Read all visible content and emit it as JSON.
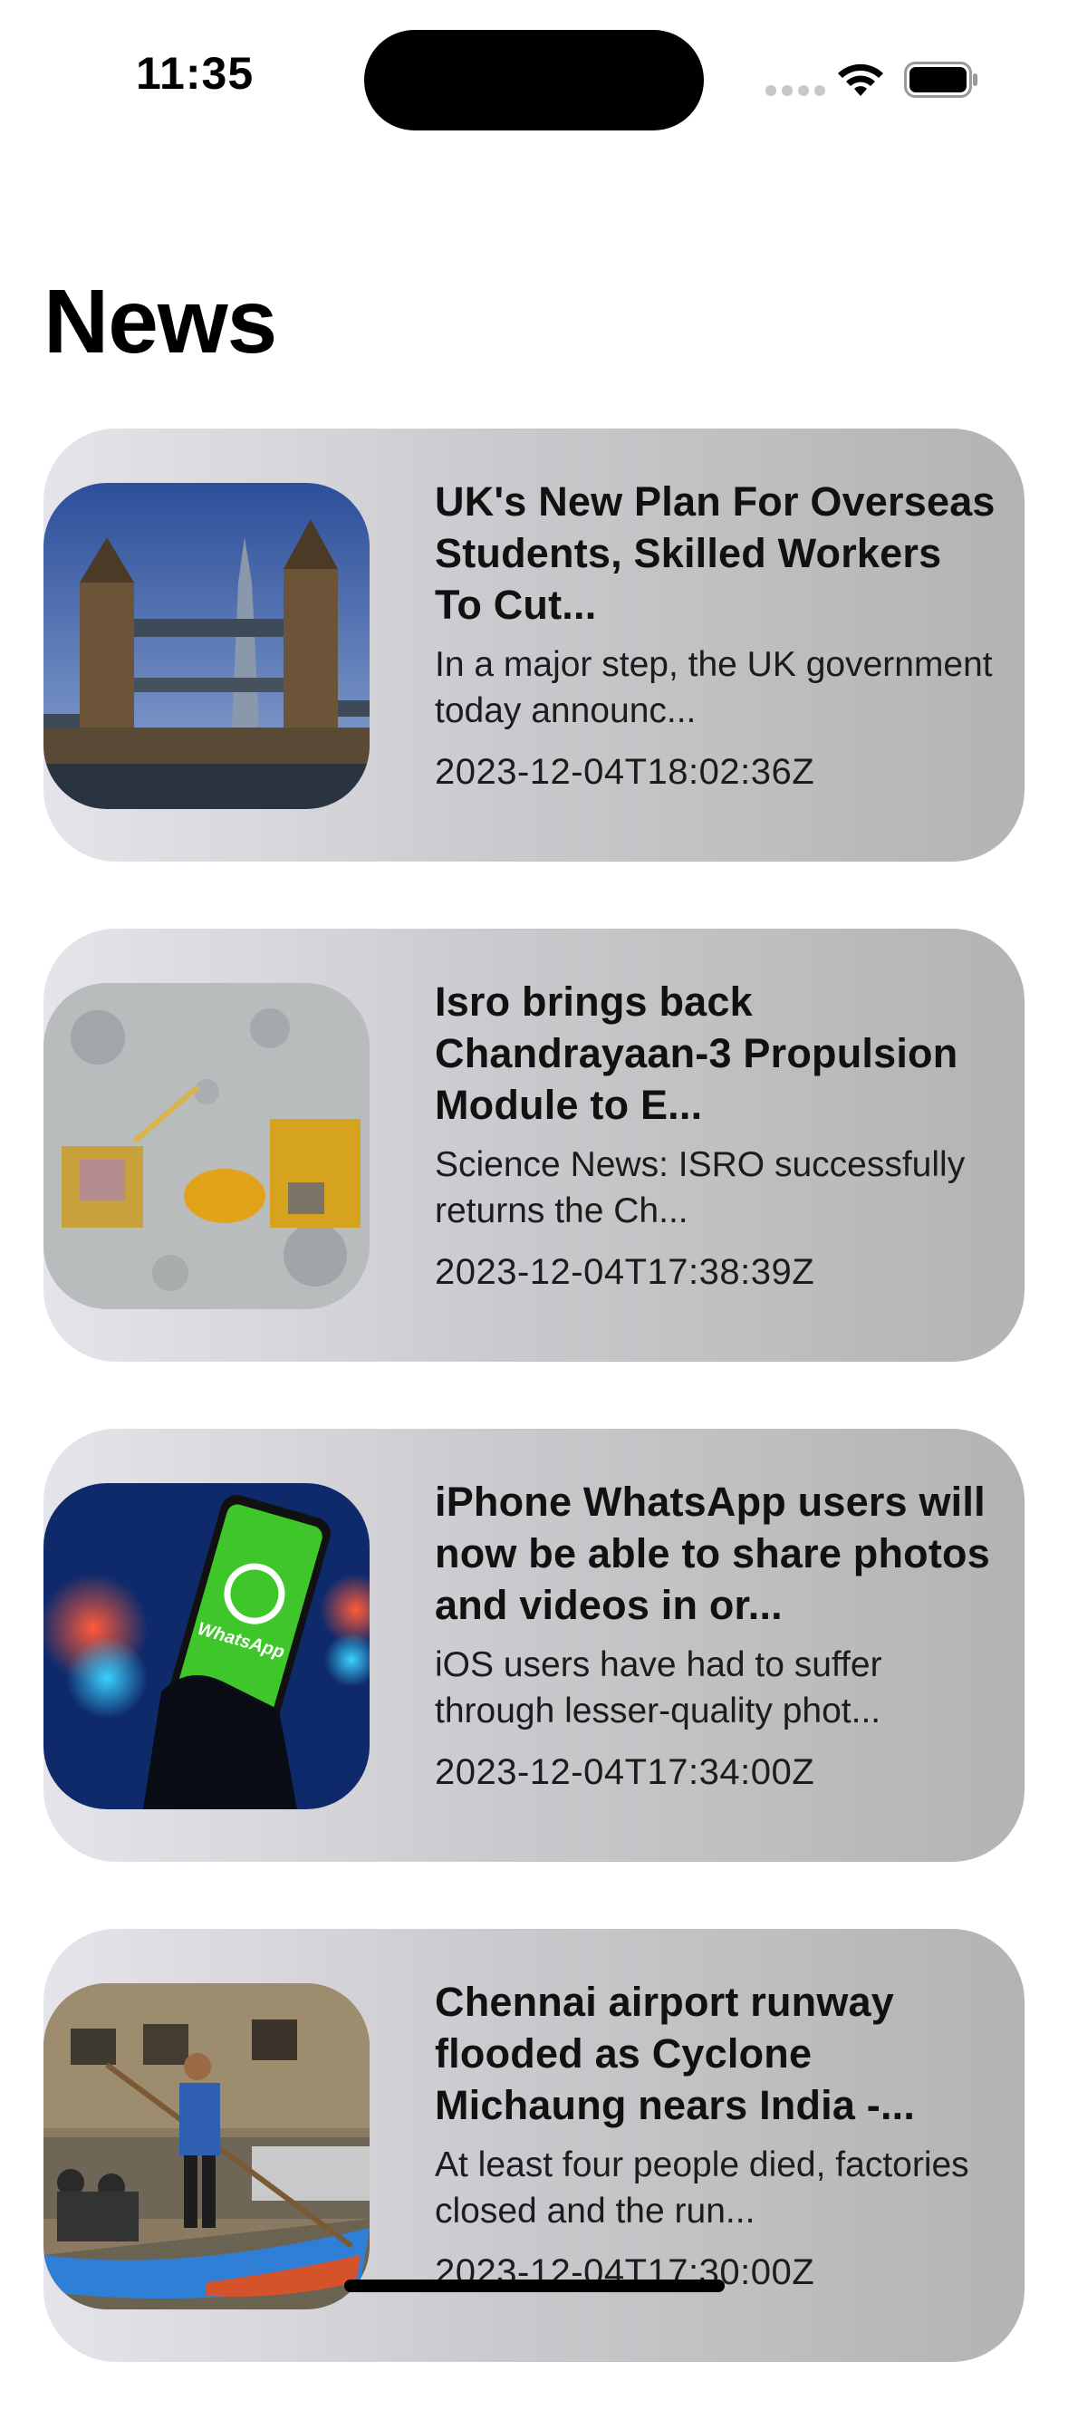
{
  "status_bar": {
    "time": "11:35",
    "icons": [
      "signal-icon",
      "wifi-icon",
      "battery-icon"
    ]
  },
  "page": {
    "title": "News"
  },
  "articles": [
    {
      "title": "UK's New Plan For Overseas Students, Skilled Workers To Cut...",
      "description": "In a major step, the UK government today announc...",
      "published_at": "2023-12-04T18:02:36Z",
      "image": "tower-bridge-photo"
    },
    {
      "title": "Isro brings back Chandrayaan-3 Propulsion Module to E...",
      "description": "Science News: ISRO successfully returns the Ch...",
      "published_at": "2023-12-04T17:38:39Z",
      "image": "lunar-spacecraft-photo"
    },
    {
      "title": "iPhone WhatsApp users will now be able to share photos and videos in or...",
      "description": "iOS users have had to suffer through lesser-quality phot...",
      "published_at": "2023-12-04T17:34:00Z",
      "image": "whatsapp-phone-photo"
    },
    {
      "title": "Chennai airport runway flooded as Cyclone Michaung nears India -...",
      "description": "At least four people died, factories closed and the run...",
      "published_at": "2023-12-04T17:30:00Z",
      "image": "flood-boat-photo"
    }
  ],
  "colors": {
    "card_gradient_start": "#e4e4ea",
    "card_gradient_end": "#b3b3b3",
    "background": "#ffffff"
  }
}
